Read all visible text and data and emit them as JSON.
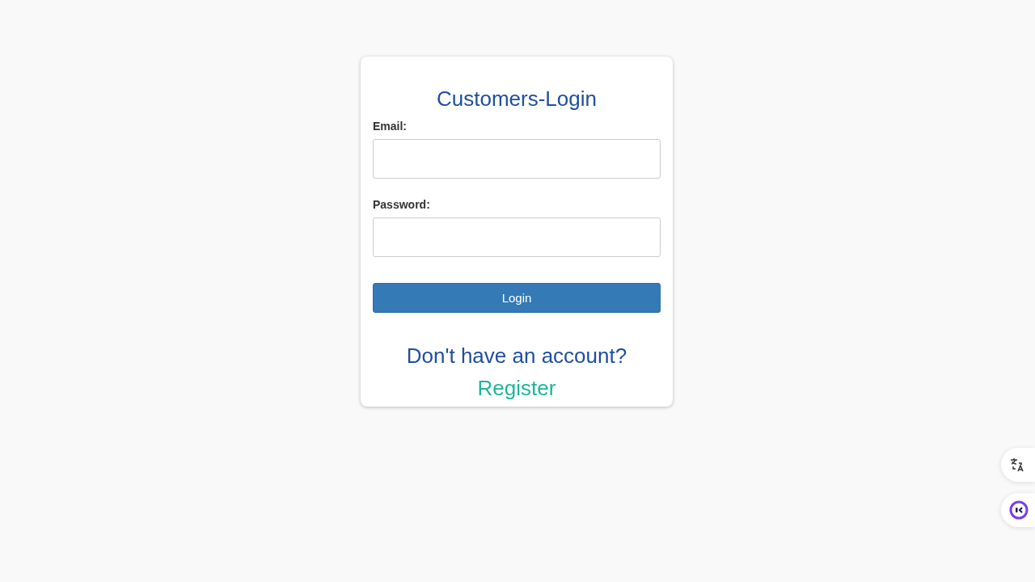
{
  "login_card": {
    "title": "Customers-Login",
    "fields": [
      {
        "label": "Email:"
      },
      {
        "label": "Password:"
      }
    ],
    "submit_button": "Login",
    "prompt": "Don't have an account?",
    "register_link": "Register"
  }
}
